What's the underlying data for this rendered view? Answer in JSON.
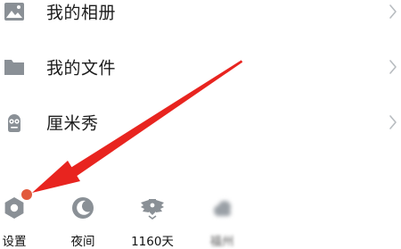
{
  "menu": {
    "items": [
      {
        "label": "我的相册",
        "icon": "image-icon"
      },
      {
        "label": "我的文件",
        "icon": "folder-icon"
      },
      {
        "label": "厘米秀",
        "icon": "qq-show-icon"
      }
    ]
  },
  "bottom_bar": {
    "items": [
      {
        "label": "设置",
        "icon": "gear-icon",
        "badge": "red-dot"
      },
      {
        "label": "夜间",
        "icon": "moon-icon"
      },
      {
        "label": "1160天",
        "icon": "wings-badge-icon"
      },
      {
        "label": "福州",
        "icon": "weather-icon"
      }
    ]
  },
  "colors": {
    "icon_gray": "#8a9096",
    "chevron_gray": "#b8bcc0",
    "badge_red": "#e25a3d",
    "annotation_arrow": "#e8241f",
    "text": "#1c1c1c"
  }
}
